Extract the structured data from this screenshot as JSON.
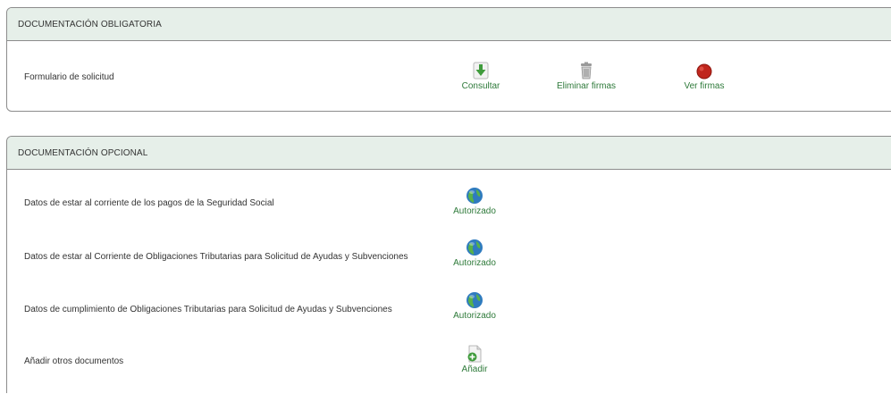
{
  "mandatory": {
    "title": "DOCUMENTACIÓN OBLIGATORIA",
    "rows": [
      {
        "label": "Formulario de solicitud",
        "actions": [
          {
            "label": "Consultar",
            "icon": "download-arrow-icon"
          },
          {
            "label": "Eliminar firmas",
            "icon": "trash-can-icon"
          },
          {
            "label": "Ver firmas",
            "icon": "wax-seal-icon"
          }
        ]
      }
    ]
  },
  "optional": {
    "title": "DOCUMENTACIÓN OPCIONAL",
    "rows": [
      {
        "label": "Datos de estar al corriente de los pagos de la Seguridad Social",
        "action": "Autorizado",
        "icon": "globe-icon"
      },
      {
        "label": "Datos de estar al Corriente de Obligaciones Tributarias para Solicitud de Ayudas y Subvenciones",
        "action": "Autorizado",
        "icon": "globe-icon"
      },
      {
        "label": "Datos de cumplimiento de Obligaciones Tributarias para Solicitud de Ayudas y Subvenciones",
        "action": "Autorizado",
        "icon": "globe-icon"
      },
      {
        "label": "Añadir otros documentos",
        "action": "Añadir",
        "icon": "add-document-icon"
      }
    ]
  },
  "colors": {
    "header_bg": "#e6efe9",
    "link_green": "#2e7a3a",
    "border": "#8c8c8c"
  }
}
